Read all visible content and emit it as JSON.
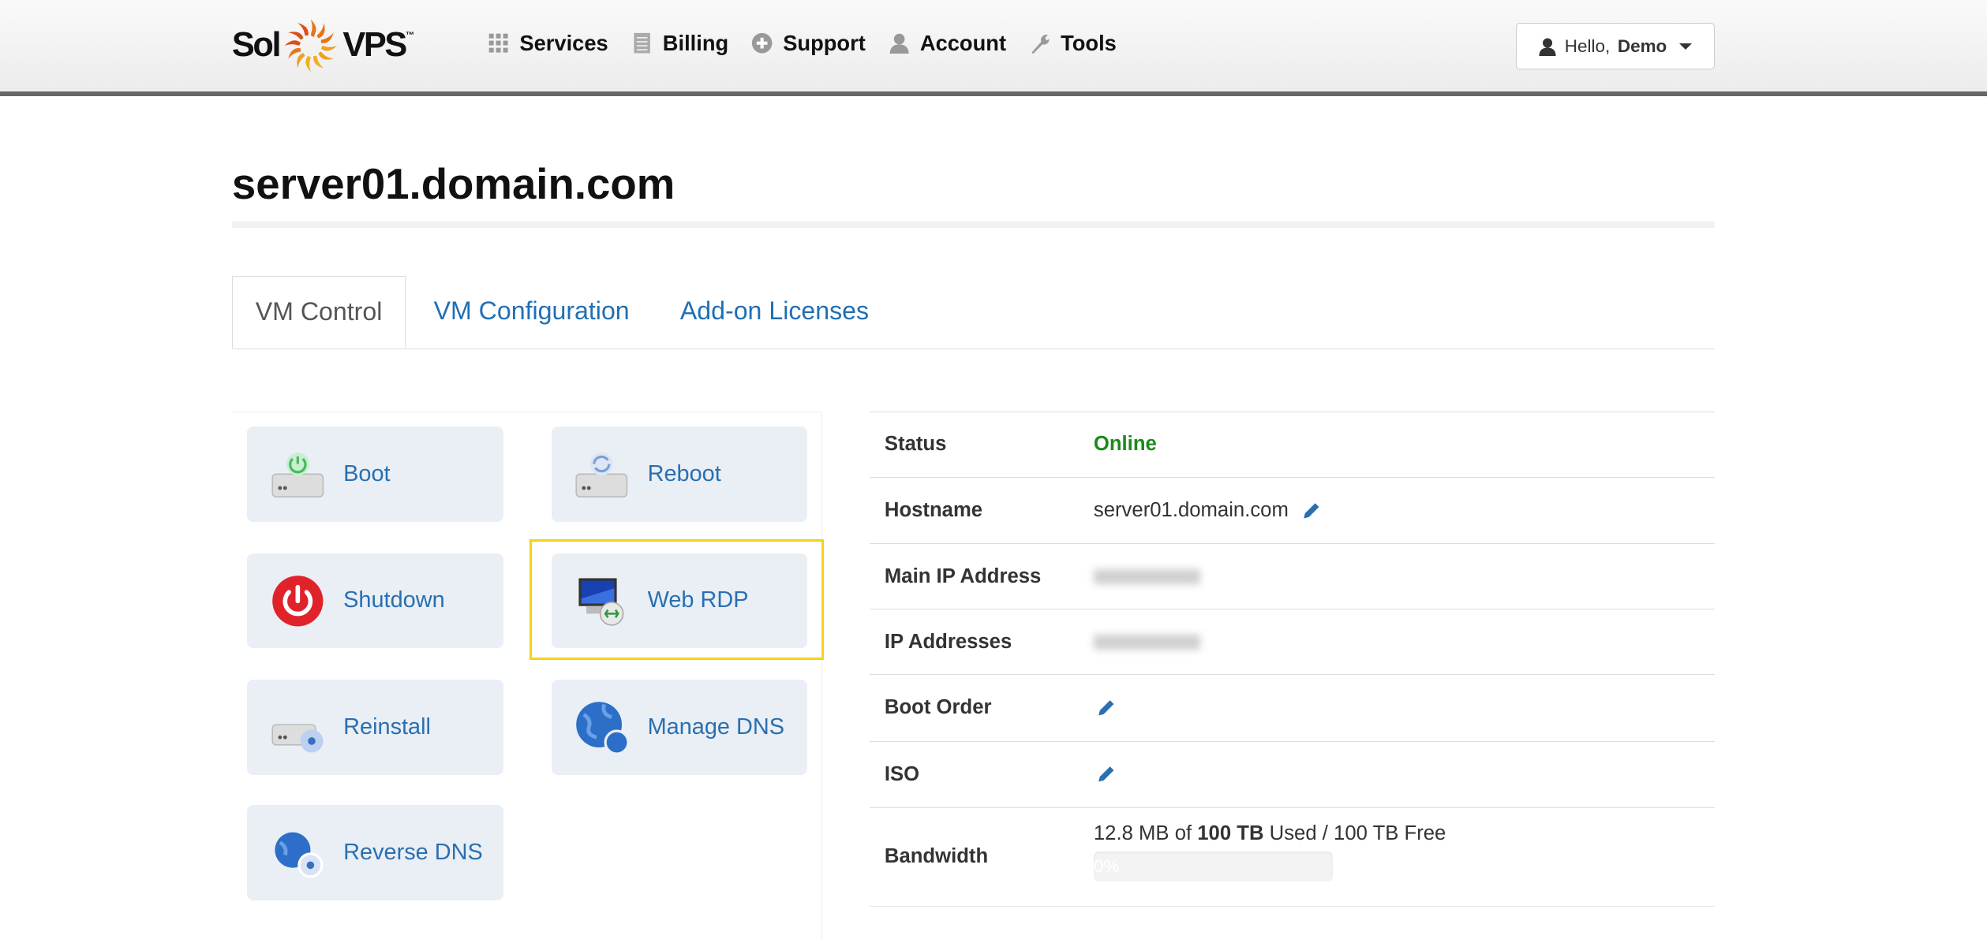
{
  "header": {
    "logo_text_left": "Sol",
    "logo_text_right": "VPS",
    "logo_tm": "™",
    "nav": [
      {
        "label": "Services",
        "icon": "grid-icon"
      },
      {
        "label": "Billing",
        "icon": "list-icon"
      },
      {
        "label": "Support",
        "icon": "plus-circle-icon"
      },
      {
        "label": "Account",
        "icon": "user-icon"
      },
      {
        "label": "Tools",
        "icon": "wrench-icon"
      }
    ],
    "user_menu": {
      "greeting": "Hello,",
      "name": "Demo"
    }
  },
  "page": {
    "title": "server01.domain.com"
  },
  "tabs": [
    {
      "label": "VM Control",
      "active": true
    },
    {
      "label": "VM Configuration"
    },
    {
      "label": "Add-on Licenses"
    }
  ],
  "actions": [
    {
      "label": "Boot"
    },
    {
      "label": "Reboot"
    },
    {
      "label": "Shutdown"
    },
    {
      "label": "Web RDP",
      "highlighted": true
    },
    {
      "label": "Reinstall"
    },
    {
      "label": "Manage DNS"
    },
    {
      "label": "Reverse DNS"
    }
  ],
  "details": {
    "status": {
      "label": "Status",
      "value": "Online",
      "color": "#1a8a1a"
    },
    "hostname": {
      "label": "Hostname",
      "value": "server01.domain.com"
    },
    "main_ip": {
      "label": "Main IP Address"
    },
    "ip_addresses": {
      "label": "IP Addresses"
    },
    "boot_order": {
      "label": "Boot Order"
    },
    "iso": {
      "label": "ISO"
    },
    "bandwidth": {
      "label": "Bandwidth",
      "used": "12.8 MB",
      "of": "of",
      "total": "100 TB",
      "rest": "Used / 100 TB Free",
      "percent_label": "0%",
      "percent": 0
    }
  },
  "colors": {
    "link": "#1f6fb5",
    "highlight": "#f3d21e",
    "button_bg": "#e9eff5"
  }
}
